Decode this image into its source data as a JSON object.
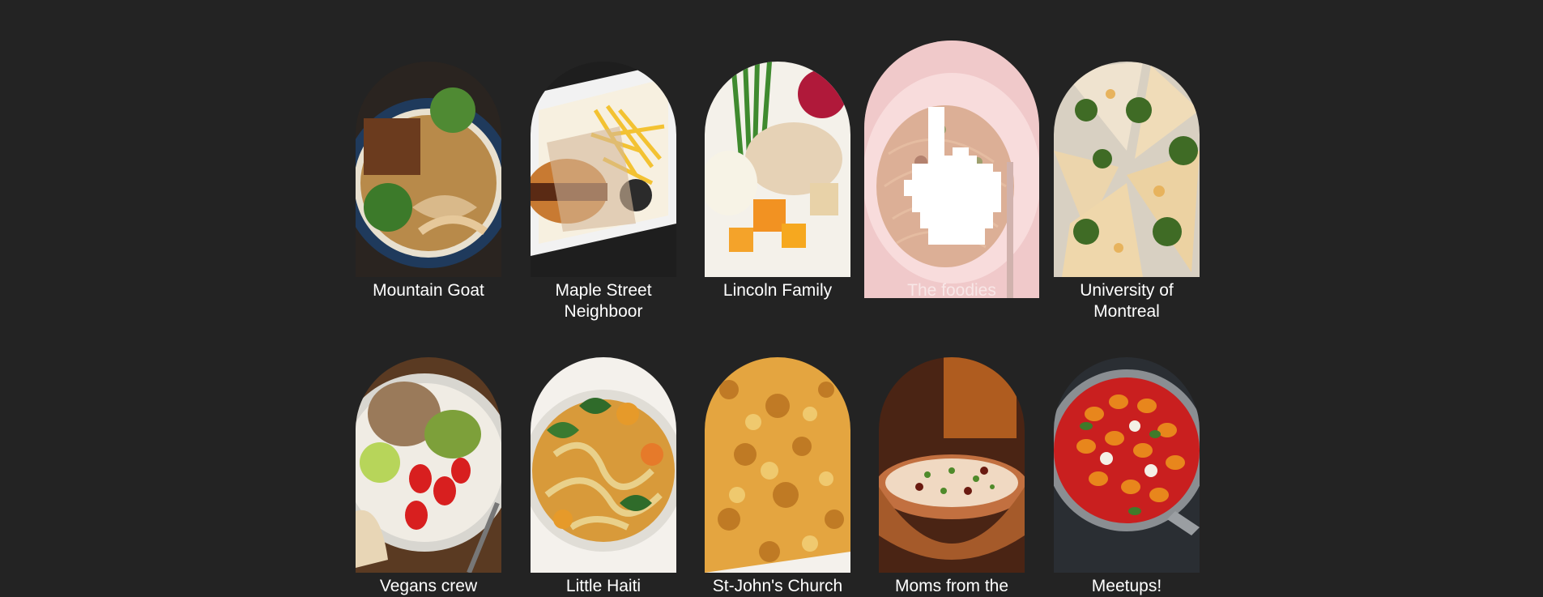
{
  "groups": [
    {
      "label": "Mountain Goat",
      "image": "noodle-soup-bowl",
      "colors": [
        "#1f3a5c",
        "#d9b98a",
        "#3c7a2a",
        "#6b3b1e"
      ]
    },
    {
      "label": "Maple Street Neighboor",
      "image": "burger-and-fries",
      "colors": [
        "#f2f2f2",
        "#f3c232",
        "#8a4a20",
        "#2b2b2b"
      ]
    },
    {
      "label": "Lincoln Family",
      "image": "turkey-dinner-plate",
      "colors": [
        "#f4f1ea",
        "#3f8a2f",
        "#f29222",
        "#b0193a"
      ]
    },
    {
      "label": "The foodies",
      "image": "pasta-plate",
      "colors": [
        "#e8c9c6",
        "#caa277",
        "#8a5b3a",
        "#a8b58a"
      ]
    },
    {
      "label": "University of Montreal",
      "image": "pizza-slices",
      "colors": [
        "#efe3cf",
        "#e7b35d",
        "#3f6b25",
        "#d8d0c2"
      ]
    },
    {
      "label": "Vegans crew",
      "image": "salad-bowl",
      "colors": [
        "#5a3a22",
        "#d81f1f",
        "#7da03a",
        "#9a7a5a"
      ]
    },
    {
      "label": "Little Haiti",
      "image": "noodle-vegetable-soup",
      "colors": [
        "#f4f1ec",
        "#e69a2a",
        "#2f6b2a",
        "#e9d08a"
      ]
    },
    {
      "label": "St-John's Church",
      "image": "baked-casserole",
      "colors": [
        "#e4a540",
        "#b7701e",
        "#f2d27a",
        "#8a4a16"
      ]
    },
    {
      "label": "Moms from the",
      "image": "chili-bowl",
      "colors": [
        "#6a2a14",
        "#c27040",
        "#f0d9c2",
        "#4f8a2a"
      ]
    },
    {
      "label": "Meetups!",
      "image": "gnocchi-pan",
      "colors": [
        "#2a2e33",
        "#e8861c",
        "#c91f1f",
        "#3f7a2a"
      ]
    }
  ],
  "hovered_index": 3,
  "cursor": "pointing-hand-icon"
}
